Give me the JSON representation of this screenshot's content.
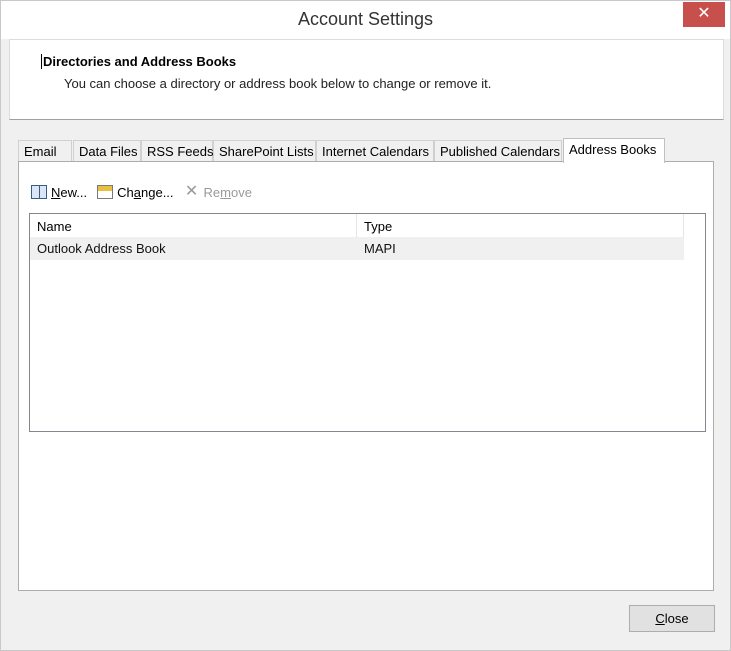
{
  "window": {
    "title": "Account Settings",
    "close_glyph": "✕"
  },
  "header": {
    "title": "Directories and Address Books",
    "description": "You can choose a directory or address book below to change or remove it."
  },
  "tabs": [
    {
      "label": "Email",
      "active": false
    },
    {
      "label": "Data Files",
      "active": false
    },
    {
      "label": "RSS Feeds",
      "active": false
    },
    {
      "label": "SharePoint Lists",
      "active": false
    },
    {
      "label": "Internet Calendars",
      "active": false
    },
    {
      "label": "Published Calendars",
      "active": false
    },
    {
      "label": "Address Books",
      "active": true
    }
  ],
  "toolbar": {
    "new": {
      "pre": "",
      "accel": "N",
      "post": "ew...",
      "icon": "address-book-icon",
      "enabled": true
    },
    "change": {
      "pre": "Ch",
      "accel": "a",
      "post": "nge...",
      "icon": "change-icon",
      "enabled": true
    },
    "remove": {
      "pre": "Re",
      "accel": "m",
      "post": "ove",
      "icon": "remove-x-icon",
      "enabled": false,
      "glyph": "✕"
    }
  },
  "list": {
    "columns": [
      "Name",
      "Type"
    ],
    "rows": [
      {
        "name": "Outlook Address Book",
        "type": "MAPI",
        "selected": true
      }
    ]
  },
  "footer": {
    "close": {
      "accel": "C",
      "post": "lose"
    }
  },
  "colors": {
    "close_button_red": "#c7504d",
    "selected_row": "#f0f0f0"
  }
}
